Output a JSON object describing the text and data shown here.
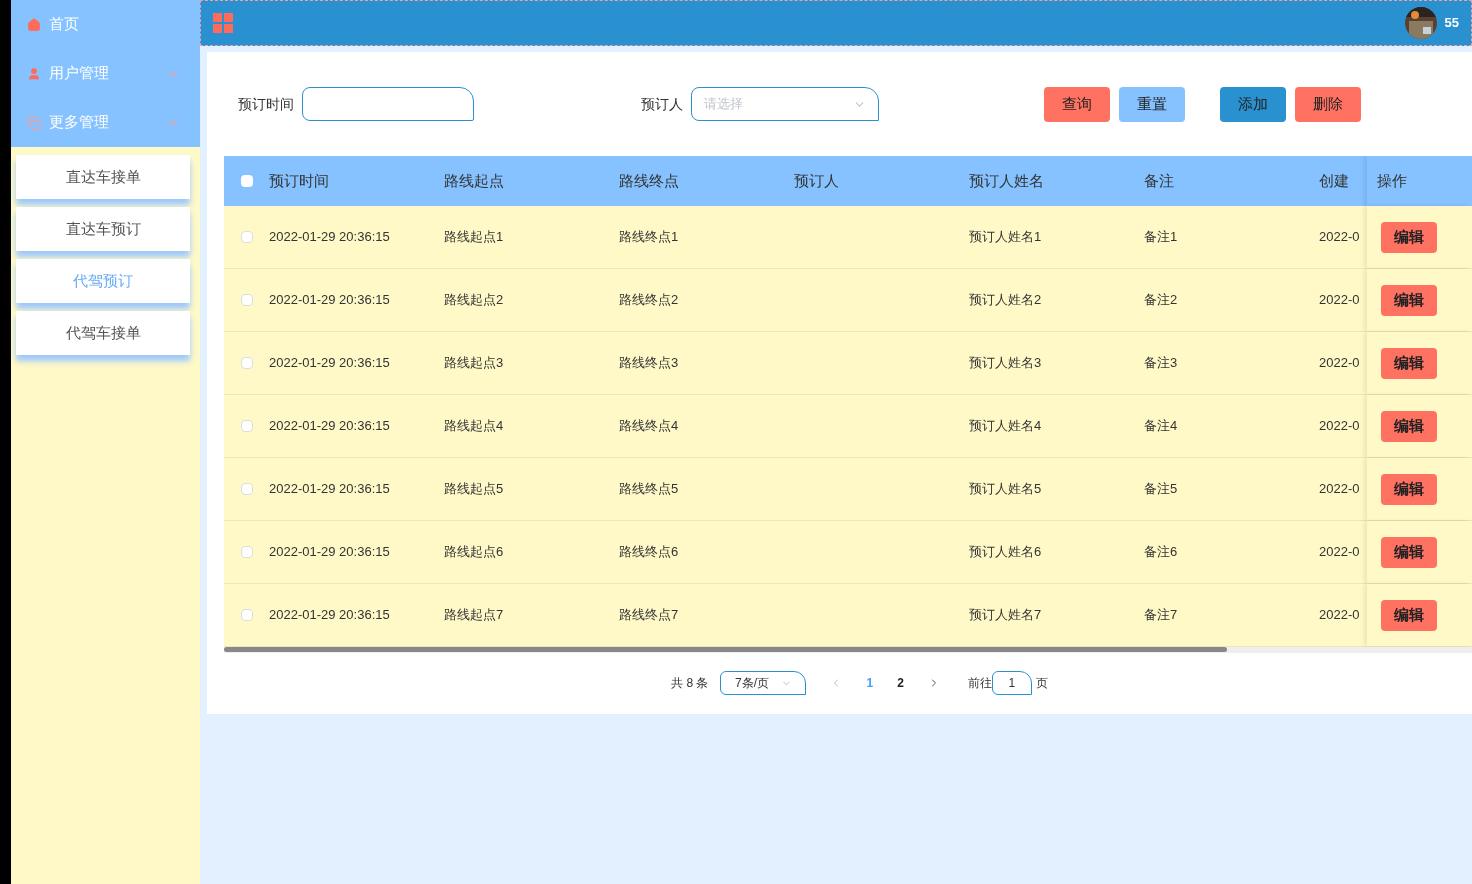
{
  "sidebar": {
    "items": [
      {
        "label": "首页",
        "kind": "home"
      },
      {
        "label": "用户管理",
        "kind": "user",
        "expanded": false
      },
      {
        "label": "更多管理",
        "kind": "copy",
        "expanded": true,
        "children": [
          {
            "label": "直达车接单",
            "selected": false
          },
          {
            "label": "直达车预订",
            "selected": false
          },
          {
            "label": "代驾预订",
            "selected": true
          },
          {
            "label": "代驾车接单",
            "selected": false
          }
        ]
      }
    ]
  },
  "topbar": {
    "username": "55"
  },
  "filters": [
    {
      "label": "预订时间",
      "kind": "input"
    },
    {
      "label": "预订人",
      "kind": "select",
      "placeholder": "请选择"
    }
  ],
  "buttons": [
    {
      "label": "查询",
      "color": "#ff7262"
    },
    {
      "label": "重置",
      "color": "#85c2ff"
    },
    {
      "label": "添加",
      "color": "#2a91d0"
    },
    {
      "label": "删除",
      "color": "#ff7262"
    }
  ],
  "table": {
    "all_checked": false,
    "columns": [
      "预订时间",
      "路线起点",
      "路线终点",
      "预订人",
      "预订人姓名",
      "备注",
      "创建",
      "操作"
    ],
    "rows": [
      {
        "checked": false,
        "cells": [
          "2022-01-29 20:36:15",
          "路线起点1",
          "路线终点1",
          "",
          "预订人姓名1",
          "备注1",
          "2022-0"
        ],
        "action": "编辑"
      },
      {
        "checked": false,
        "cells": [
          "2022-01-29 20:36:15",
          "路线起点2",
          "路线终点2",
          "",
          "预订人姓名2",
          "备注2",
          "2022-0"
        ],
        "action": "编辑"
      },
      {
        "checked": false,
        "cells": [
          "2022-01-29 20:36:15",
          "路线起点3",
          "路线终点3",
          "",
          "预订人姓名3",
          "备注3",
          "2022-0"
        ],
        "action": "编辑"
      },
      {
        "checked": false,
        "cells": [
          "2022-01-29 20:36:15",
          "路线起点4",
          "路线终点4",
          "",
          "预订人姓名4",
          "备注4",
          "2022-0"
        ],
        "action": "编辑"
      },
      {
        "checked": false,
        "cells": [
          "2022-01-29 20:36:15",
          "路线起点5",
          "路线终点5",
          "",
          "预订人姓名5",
          "备注5",
          "2022-0"
        ],
        "action": "编辑"
      },
      {
        "checked": false,
        "cells": [
          "2022-01-29 20:36:15",
          "路线起点6",
          "路线终点6",
          "",
          "预订人姓名6",
          "备注6",
          "2022-0"
        ],
        "action": "编辑"
      },
      {
        "checked": false,
        "cells": [
          "2022-01-29 20:36:15",
          "路线起点7",
          "路线终点7",
          "",
          "预订人姓名7",
          "备注7",
          "2022-0"
        ],
        "action": "编辑"
      }
    ]
  },
  "pagination": {
    "total": "共 8 条",
    "page_size": "7条/页",
    "pages": [
      {
        "label": "1",
        "selected": true
      },
      {
        "label": "2",
        "selected": false
      }
    ],
    "goto_label": "前往",
    "goto_value": "1",
    "goto_suffix": "页"
  }
}
